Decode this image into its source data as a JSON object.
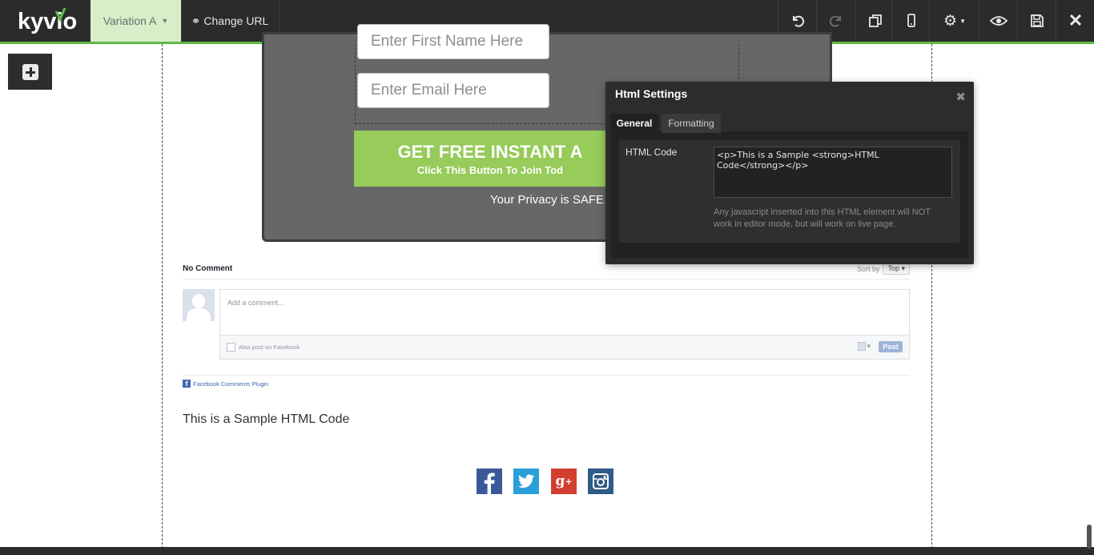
{
  "toolbar": {
    "brand": "kyvio",
    "variation_label": "Variation A",
    "change_url_label": "Change URL",
    "accent_color": "#5fb94a",
    "icons": [
      "undo-icon",
      "redo-icon",
      "copy-icon",
      "mobile-icon",
      "gear-icon",
      "eye-icon",
      "save-icon",
      "close-icon"
    ]
  },
  "optin": {
    "first_name_placeholder": "Enter First Name Here",
    "email_placeholder": "Enter Email Here",
    "cta_title": "GET FREE INSTANT A",
    "cta_sub": "Click This Button To Join Tod",
    "privacy": "Your Privacy is SAFE",
    "cta_color": "#97cb5a"
  },
  "comments": {
    "count_label": "No Comment",
    "sort_label": "Sort by",
    "sort_value": "Top",
    "placeholder": "Add a comment...",
    "also_post": "Also post on Facebook",
    "post_button": "Post",
    "plugin_label": "Facebook Comments Plugin"
  },
  "sample": {
    "prefix": "This is a Sample ",
    "strong": "HTML Code"
  },
  "social": [
    "facebook-icon",
    "twitter-icon",
    "google-plus-icon",
    "instagram-icon"
  ],
  "modal": {
    "title": "Html Settings",
    "tabs": [
      "General",
      "Formatting"
    ],
    "field_label": "HTML Code",
    "code_value": "<p>This is a Sample <strong>HTML Code</strong></p>",
    "help_text": "Any javascript inserted into this HTML element will NOT work in editor mode, but will work on live page."
  }
}
